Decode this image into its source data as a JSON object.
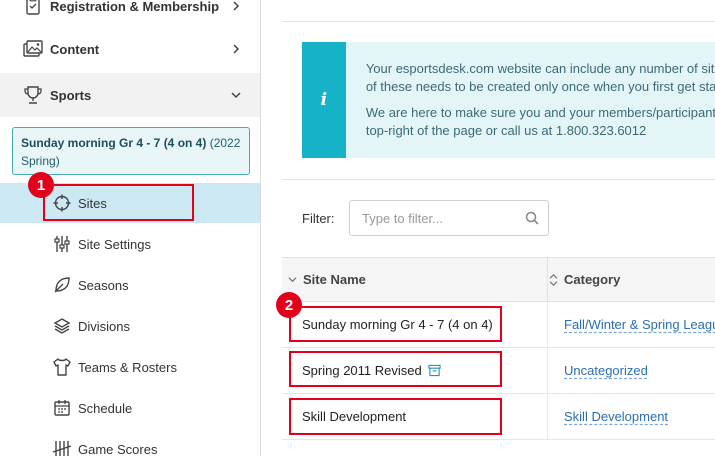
{
  "sidebar": {
    "items": [
      {
        "label": "Registration & Membership",
        "icon": "clipboard-icon"
      },
      {
        "label": "Content",
        "icon": "images-icon"
      },
      {
        "label": "Sports",
        "icon": "trophy-icon"
      }
    ],
    "context": {
      "title": "Sunday morning Gr 4 - 7 (4 on 4)",
      "season": "(2022 Spring)"
    },
    "subitems": [
      {
        "label": "Sites",
        "icon": "crosshair-icon",
        "active": true
      },
      {
        "label": "Site Settings",
        "icon": "sliders-icon"
      },
      {
        "label": "Seasons",
        "icon": "leaf-icon"
      },
      {
        "label": "Divisions",
        "icon": "layers-icon"
      },
      {
        "label": "Teams & Rosters",
        "icon": "shirt-icon"
      },
      {
        "label": "Schedule",
        "icon": "calendar-icon"
      },
      {
        "label": "Game Scores",
        "icon": "tally-icon"
      }
    ]
  },
  "alert": {
    "line1": "Your esportsdesk.com website can include any number of sit",
    "line2": "of these needs to be created only once when you first get sta",
    "line3": "We are here to make sure you and your members/participant",
    "line4": "top-right of the page or call us at 1.800.323.6012"
  },
  "filter": {
    "label": "Filter:",
    "placeholder": "Type to filter..."
  },
  "table": {
    "headers": {
      "name": "Site Name",
      "category": "Category"
    },
    "rows": [
      {
        "name": "Sunday morning Gr 4 - 7 (4 on 4)",
        "category": "Fall/Winter & Spring League"
      },
      {
        "name": "Spring 2011 Revised",
        "category": "Uncategorized",
        "archived": true
      },
      {
        "name": "Skill Development",
        "category": "Skill Development"
      }
    ]
  },
  "annotations": {
    "badge1": "1",
    "badge2": "2"
  },
  "colors": {
    "accent": "#16b3c8",
    "highlight": "#e3001b",
    "active_bg": "#cce8f3",
    "link": "#2a6fb5"
  }
}
